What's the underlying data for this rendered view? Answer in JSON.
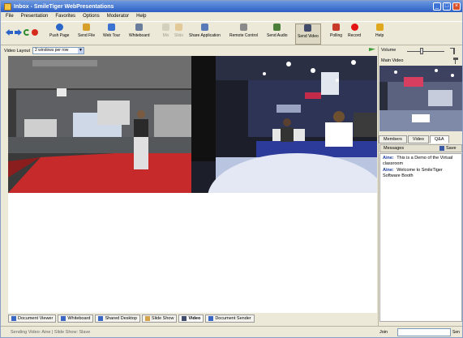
{
  "window": {
    "title": "Inbox - SmileTiger WebPresentations"
  },
  "menu": [
    "File",
    "Presentation",
    "Favorites",
    "Options",
    "Moderator",
    "Help"
  ],
  "toolbar": {
    "buttons": [
      {
        "label": "Push Page",
        "icon": "globe-icon",
        "color": "#2a66c9"
      },
      {
        "label": "Send File",
        "icon": "folder-icon",
        "color": "#d7a02a"
      },
      {
        "label": "Web Tour",
        "icon": "webtour-icon",
        "color": "#3c72d1"
      },
      {
        "label": "Whiteboard",
        "icon": "whiteboard-icon",
        "color": "#6a7d9c"
      },
      {
        "label": "Mix",
        "icon": "mix-icon",
        "color": "#b8b2a0"
      },
      {
        "label": "Slide",
        "icon": "slide-icon",
        "color": "#d6a24a"
      },
      {
        "label": "Share Application",
        "icon": "share-app-icon",
        "color": "#587ab8"
      },
      {
        "label": "Remote Control",
        "icon": "remote-control-icon",
        "color": "#8a8a8a"
      },
      {
        "label": "Send Audio",
        "icon": "speaker-icon",
        "color": "#4c7f3a"
      },
      {
        "label": "Send Video",
        "icon": "camera-icon",
        "color": "#414b6a"
      },
      {
        "label": "Polling",
        "icon": "polling-icon",
        "color": "#c83a2a"
      },
      {
        "label": "Record",
        "icon": "record-icon",
        "color": "#e21414"
      },
      {
        "label": "Help",
        "icon": "help-icon",
        "color": "#e0a81e"
      }
    ]
  },
  "video_layout": {
    "label": "Video Layout",
    "selected": "2 windows per row"
  },
  "bottom_tabs": [
    {
      "label": "Document Viewer",
      "icon": "document-icon"
    },
    {
      "label": "Whiteboard",
      "icon": "whiteboard-icon"
    },
    {
      "label": "Shared Desktop",
      "icon": "desktop-icon"
    },
    {
      "label": "Slide Show",
      "icon": "slideshow-icon"
    },
    {
      "label": "Video",
      "icon": "video-icon"
    },
    {
      "label": "Document Sender",
      "icon": "document-sender-icon"
    }
  ],
  "status": {
    "text": "Sending Video: Aine | Slide Show: Slave",
    "join_label": "Join",
    "send_label": "Sen"
  },
  "right_panel": {
    "volume_label": "Volume",
    "volume_level": 0.4,
    "main_video_label": "Main Video",
    "tabs": [
      "Members",
      "Video",
      "Q&A"
    ],
    "active_tab": "Q&A",
    "messages_label": "Messages",
    "save_label": "Save",
    "messages": [
      {
        "author": "Aine:",
        "text": "This is a Demo of the Virtual classroom"
      },
      {
        "author": "Aine:",
        "text": "Welcome to SmileTiger Software Booth"
      }
    ]
  }
}
